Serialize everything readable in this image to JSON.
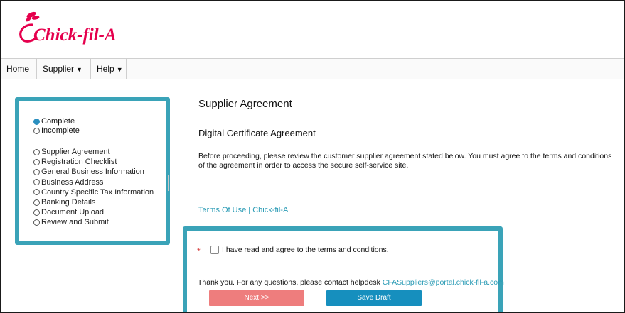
{
  "brand": {
    "logo_text": "Chick-fil-A",
    "primary_color": "#e5004d",
    "accent_color": "#3aa3b8"
  },
  "nav": {
    "items": [
      {
        "label": "Home",
        "has_caret": false
      },
      {
        "label": "Supplier",
        "has_caret": true
      },
      {
        "label": "Help",
        "has_caret": true
      }
    ],
    "caret_glyph": "▼"
  },
  "status_legend": {
    "complete": "Complete",
    "incomplete": "Incomplete"
  },
  "steps": [
    "Supplier Agreement",
    "Registration Checklist",
    "General Business Information",
    "Business Address",
    "Country Specific Tax Information",
    "Banking Details",
    "Document Upload",
    "Review and Submit"
  ],
  "main": {
    "title": "Supplier Agreement",
    "subtitle": "Digital Certificate Agreement",
    "intro": "Before proceeding, please review the customer supplier agreement stated below. You must agree to the terms and conditions of the agreement in order to access the secure self-service site.",
    "terms_link": "Terms Of Use | Chick-fil-A"
  },
  "agreement": {
    "required_mark": "*",
    "checkbox_label": "I have read and agree to the terms and conditions.",
    "checked": false,
    "help_text": "Thank you. For any questions, please contact helpdesk",
    "help_email": "CFASuppliers@portal.chick-fil-a.com",
    "next_label": "Next >>",
    "save_label": "Save Draft"
  }
}
